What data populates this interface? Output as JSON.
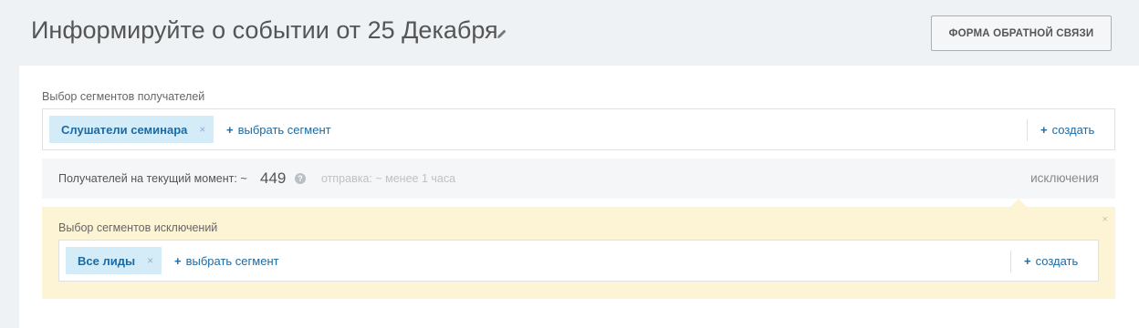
{
  "header": {
    "title": "Информируйте о событии от 25 Декабря",
    "feedback_button": "ФОРМА ОБРАТНОЙ СВЯЗИ"
  },
  "recipients_segments": {
    "label": "Выбор сегментов получателей",
    "chips": [
      {
        "label": "Слушатели семинара",
        "remove": "×"
      }
    ],
    "add_label": "выбрать сегмент",
    "create_label": "создать"
  },
  "recipients_info": {
    "label": "Получателей на текущий момент: ~",
    "count": "449",
    "help": "?",
    "send_info": "отправка: ~ менее 1 часа",
    "exclusions_link": "исключения"
  },
  "exclusion_segments": {
    "label": "Выбор сегментов исключений",
    "chips": [
      {
        "label": "Все лиды",
        "remove": "×"
      }
    ],
    "add_label": "выбрать сегмент",
    "create_label": "создать",
    "close": "×"
  },
  "icons": {
    "plus": "+",
    "edit": "pencil-icon"
  }
}
